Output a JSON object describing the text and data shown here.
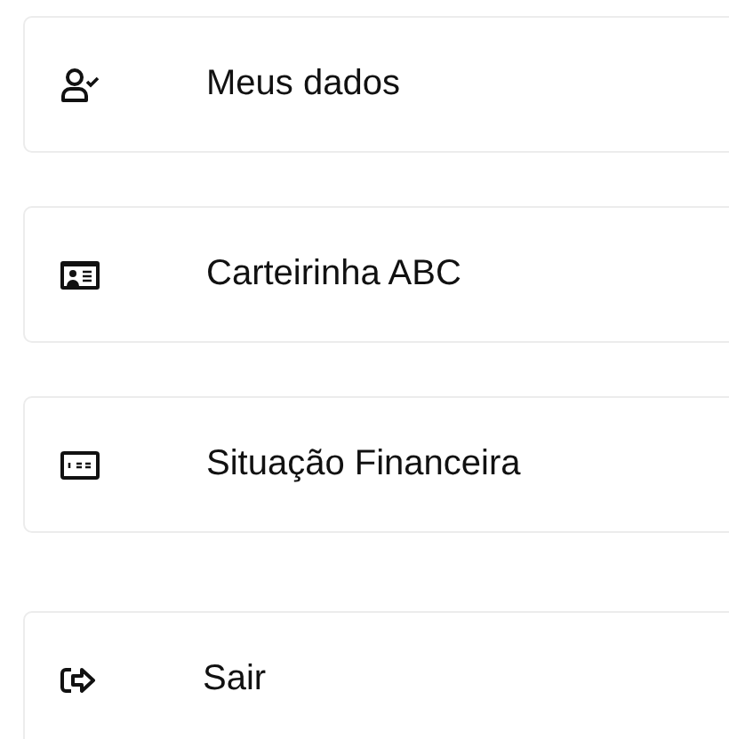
{
  "sections": [
    {
      "items": [
        {
          "kind": "user-check",
          "label": "Meus dados"
        },
        {
          "kind": "id-card",
          "label": "Carteirinha ABC"
        },
        {
          "kind": "money-card",
          "label": "Situação Financeira"
        }
      ]
    },
    {
      "items": [
        {
          "kind": "logout",
          "label": "Sair"
        }
      ]
    }
  ]
}
